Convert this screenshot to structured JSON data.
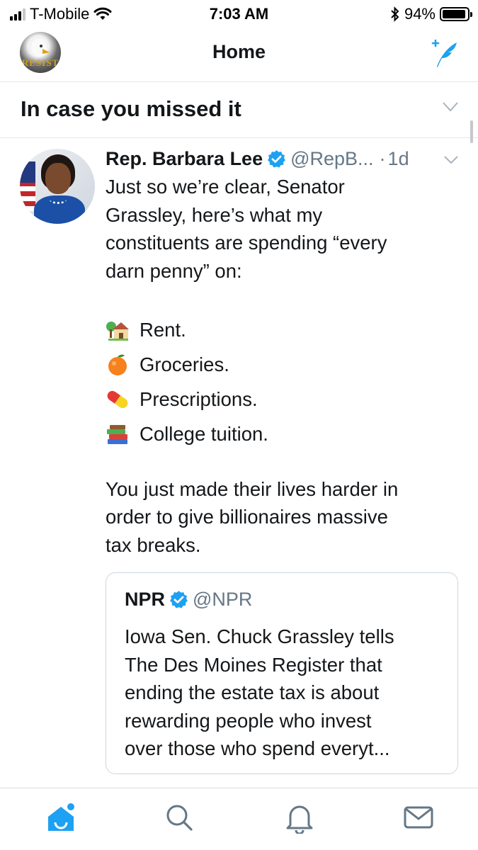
{
  "status_bar": {
    "carrier": "T-Mobile",
    "time": "7:03 AM",
    "battery": "94%",
    "battery_level": 0.94
  },
  "nav": {
    "title": "Home",
    "avatar_text": "RESIST"
  },
  "section": {
    "title": "In case you missed it"
  },
  "tweet": {
    "author_name": "Rep. Barbara Lee",
    "handle": "@RepB...",
    "separator": "·",
    "time": "1d",
    "lines": [
      "Just so we’re clear, Senator",
      "Grassley, here’s what my",
      "constituents are spending “every",
      "darn penny” on:"
    ],
    "list": [
      {
        "icon": "house-emoji-icon",
        "text": "Rent."
      },
      {
        "icon": "orange-emoji-icon",
        "text": "Groceries."
      },
      {
        "icon": "pill-emoji-icon",
        "text": "Prescriptions."
      },
      {
        "icon": "books-emoji-icon",
        "text": "College tuition."
      }
    ],
    "closing_lines": [
      "You just made their lives harder in",
      "order to give billionaires massive",
      "tax breaks."
    ]
  },
  "quote": {
    "author_name": "NPR",
    "handle": "@NPR",
    "lines": [
      "Iowa Sen. Chuck Grassley tells",
      "The Des Moines Register that",
      "ending the estate tax is about",
      "rewarding people who invest",
      "over those who spend everyt..."
    ]
  },
  "tab_bar": {
    "tabs": [
      "home-icon",
      "search-icon",
      "notifications-icon",
      "messages-icon"
    ],
    "active": "home-icon"
  },
  "colors": {
    "accent": "#1da1f2",
    "text": "#14171a",
    "secondary": "#657786",
    "divider": "#e1e8ed"
  }
}
